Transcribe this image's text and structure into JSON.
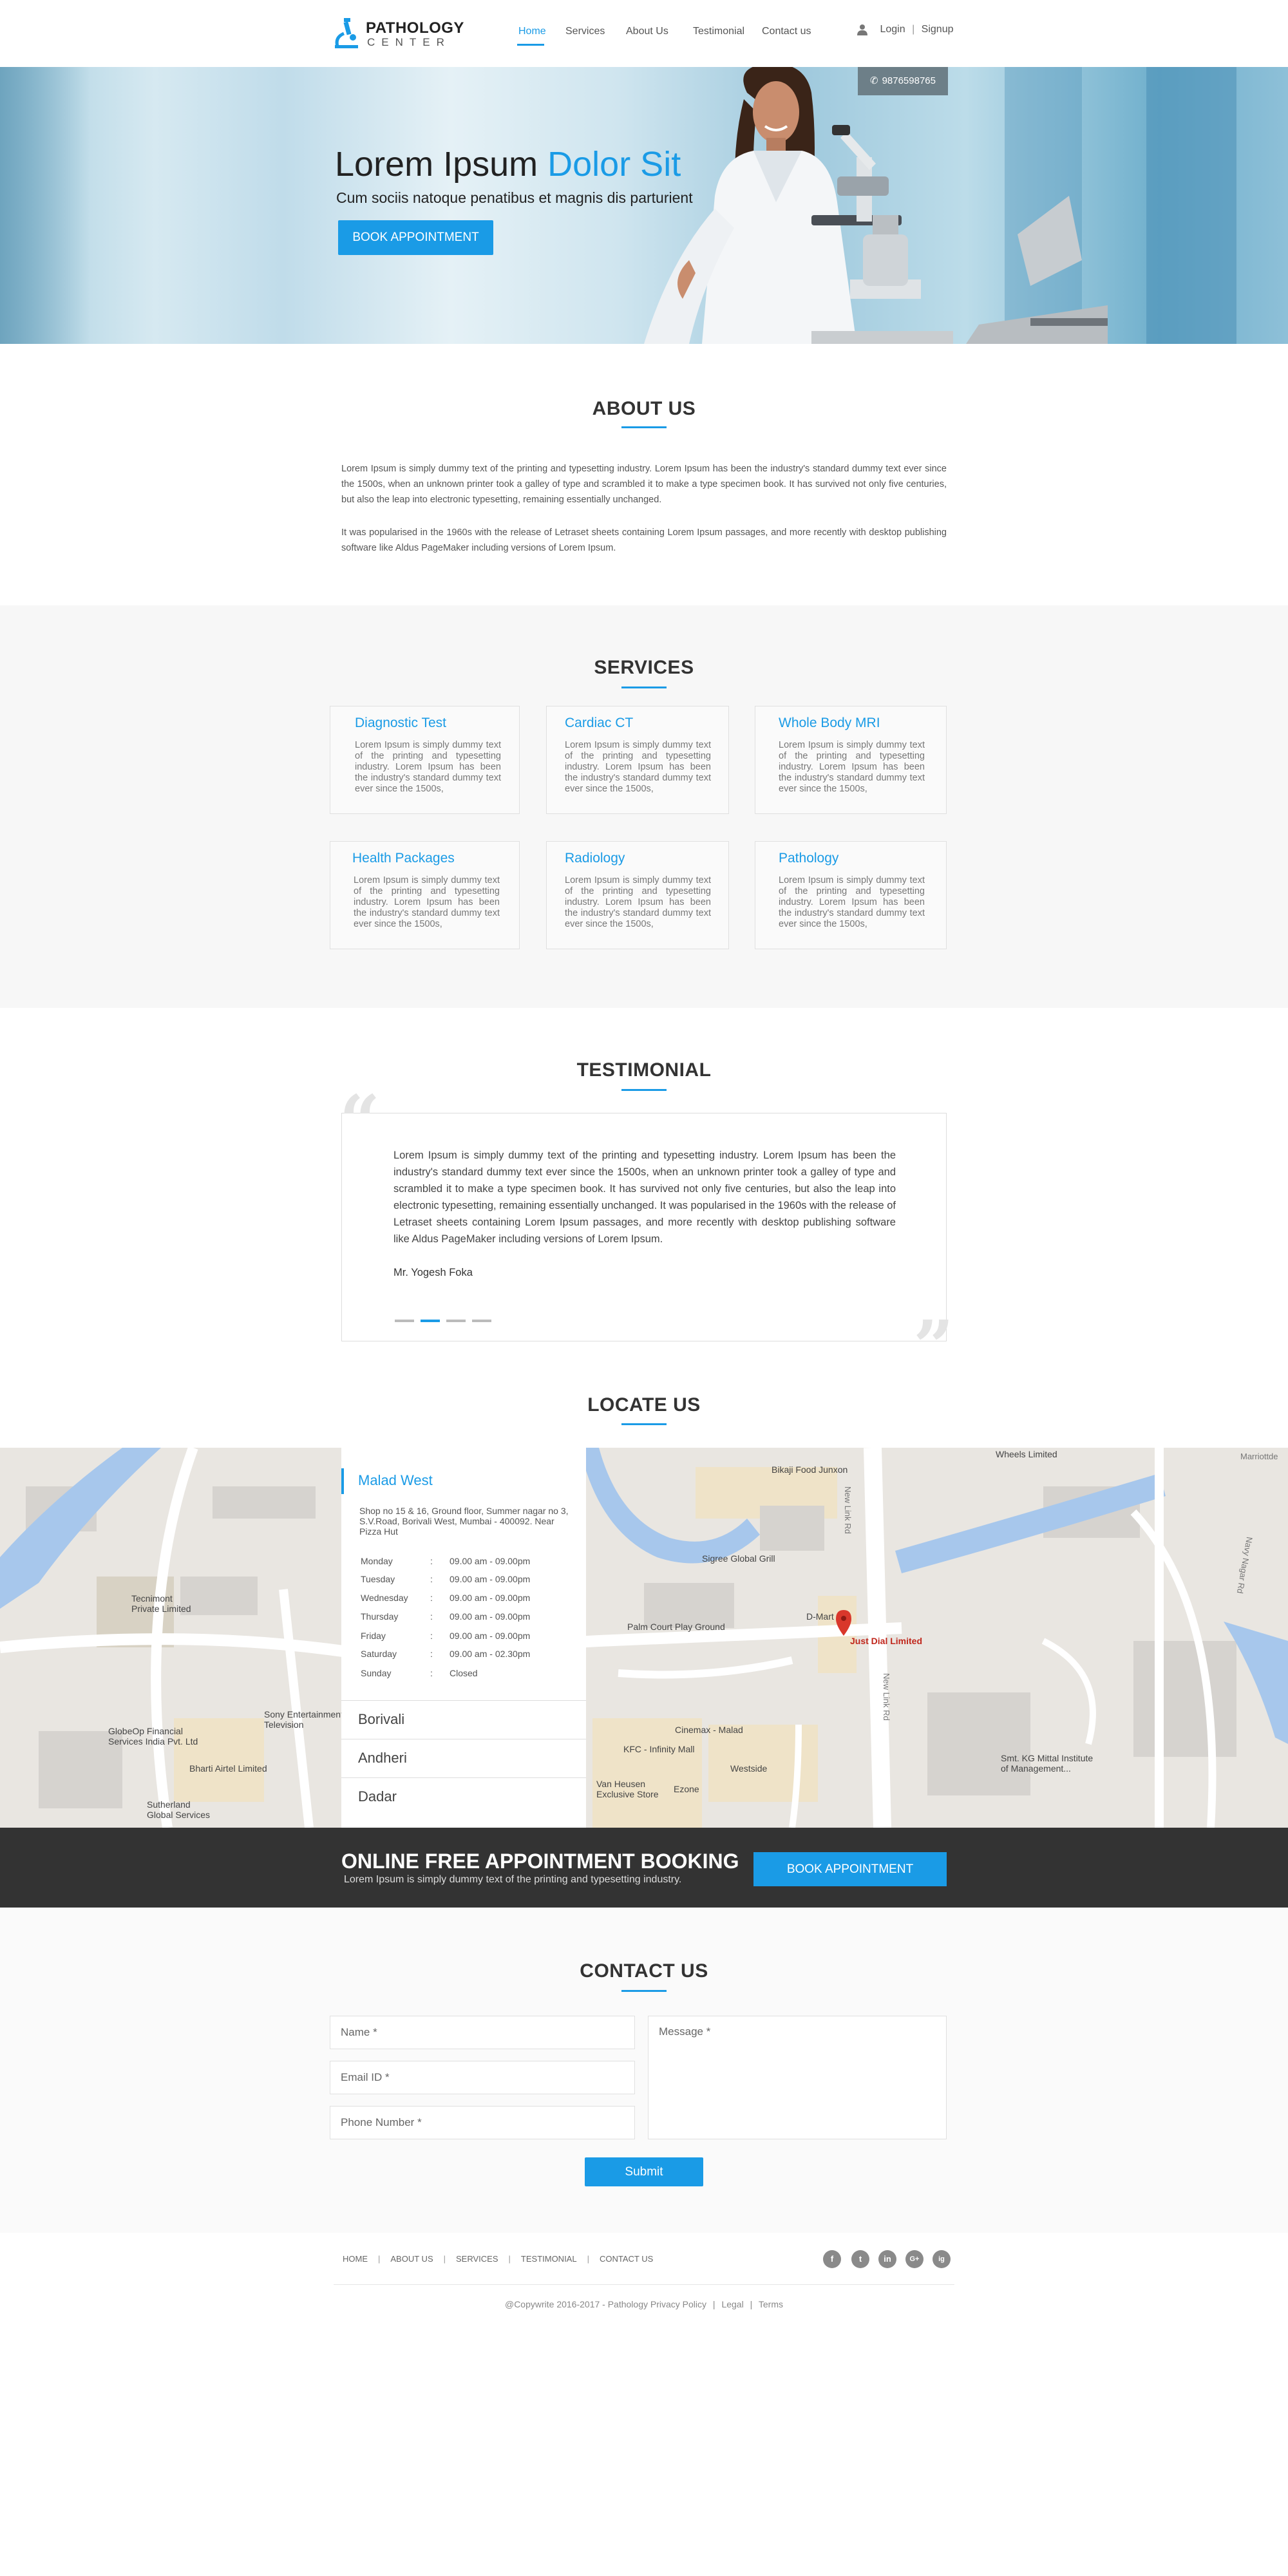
{
  "nav": {
    "logo_title": "PATHOLOGY",
    "logo_sub": "CENTER",
    "items": [
      "Home",
      "Services",
      "About Us",
      "Testimonial",
      "Contact us"
    ],
    "login": "Login",
    "divider": "|",
    "signup": "Signup"
  },
  "hero": {
    "title_plain": "Lorem Ipsum",
    "title_accent": "Dolor Sit",
    "subtitle": "Cum sociis natoque penatibus et magnis dis parturient",
    "button": "BOOK APPOINTMENT",
    "phone": "9876598765"
  },
  "about": {
    "title": "ABOUT US",
    "p1": "Lorem Ipsum is simply dummy text of the printing and typesetting industry. Lorem Ipsum has been the industry's standard dummy text ever since the 1500s, when an unknown printer took a galley of type and scrambled it to make a type specimen book. It has survived not only five centuries, but also the leap into electronic typesetting, remaining essentially unchanged.",
    "p2": "It was popularised in the 1960s with the release of Letraset sheets containing Lorem Ipsum passages, and more recently with desktop publishing software like Aldus PageMaker including versions of Lorem Ipsum."
  },
  "services": {
    "title": "SERVICES",
    "items": [
      {
        "title": "Diagnostic Test",
        "desc": "Lorem Ipsum is simply dummy text of the printing and typesetting industry. Lorem Ipsum has been the industry's standard dummy text ever since the 1500s,"
      },
      {
        "title": "Cardiac CT",
        "desc": "Lorem Ipsum is simply dummy text of the printing and typesetting industry. Lorem Ipsum has been the industry's standard dummy text ever since the 1500s,"
      },
      {
        "title": "Whole Body MRI",
        "desc": "Lorem Ipsum is simply dummy text of the printing and typesetting industry. Lorem Ipsum has been the industry's standard dummy text ever since the 1500s,"
      },
      {
        "title": "Health Packages",
        "desc": "Lorem Ipsum is simply dummy text of the printing and typesetting industry. Lorem Ipsum has been the industry's standard dummy text ever since the 1500s,"
      },
      {
        "title": "Radiology",
        "desc": "Lorem Ipsum is simply dummy text of the printing and typesetting industry. Lorem Ipsum has been the industry's standard dummy text ever since the 1500s,"
      },
      {
        "title": "Pathology",
        "desc": "Lorem Ipsum is simply dummy text of the printing and typesetting industry. Lorem Ipsum has been the industry's standard dummy text ever since the 1500s,"
      }
    ]
  },
  "testimonial": {
    "title": "TESTIMONIAL",
    "text": "Lorem Ipsum is simply dummy text of the printing and typesetting industry. Lorem Ipsum has been the industry's standard dummy text ever since the 1500s, when an unknown printer took a galley of type and scrambled it to make a type specimen book. It has survived not only five centuries, but also the leap into electronic typesetting, remaining essentially unchanged. It was popularised in the 1960s with the release of Letraset sheets containing Lorem Ipsum passages, and more recently with desktop publishing software like Aldus PageMaker including versions of Lorem Ipsum.",
    "author": "Mr. Yogesh Foka",
    "open_quote": "“",
    "close_quote": "”",
    "slide_count": 4,
    "active_slide": 2
  },
  "locate": {
    "title": "LOCATE US",
    "active_location": "Malad West",
    "address": "Shop no 15 & 16, Ground floor, Summer nagar no 3, S.V.Road, Borivali West, Mumbai - 400092. Near Pizza Hut",
    "hours": [
      {
        "day": "Monday",
        "sep": ":",
        "time": "09.00 am - 09.00pm"
      },
      {
        "day": "Tuesday",
        "sep": ":",
        "time": "09.00 am - 09.00pm"
      },
      {
        "day": "Wednesday",
        "sep": ":",
        "time": "09.00 am - 09.00pm"
      },
      {
        "day": "Thursday",
        "sep": ":",
        "time": "09.00 am - 09.00pm"
      },
      {
        "day": "Friday",
        "sep": ":",
        "time": "09.00 am - 09.00pm"
      },
      {
        "day": "Saturday",
        "sep": ":",
        "time": "09.00 am - 02.30pm"
      },
      {
        "day": "Sunday",
        "sep": ":",
        "time": "Closed"
      }
    ],
    "other_locations": [
      "Borivali",
      "Andheri",
      "Dadar"
    ],
    "map_labels": {
      "tecnimont": "Tecnimont\nPrivate Limited",
      "globeop": "GlobeOp Financial\nServices India Pvt. Ltd",
      "sony": "Sony Entertainment\nTelevision",
      "bharti": "Bharti Airtel Limited",
      "sutherland": "Sutherland\nGlobal Services",
      "bikaji": "Bikaji Food Junxon",
      "sigree": "Sigree Global Grill",
      "palm": "Palm Court Play Ground",
      "dmart": "D-Mart",
      "justdial": "Just Dial Limited",
      "cinemax": "Cinemax - Malad",
      "kfc": "KFC - Infinity Mall",
      "westside": "Westside",
      "vanheusen": "Van Heusen\nExclusive Store",
      "ezone": "Ezone",
      "wheels": "Wheels Limited",
      "marriott": "Marriottde",
      "newlink1": "New Link Rd",
      "newlink2": "New Link Rd",
      "navynagar": "Navy Nagar Rd",
      "kgmittal": "Smt. KG Mittal Institute\nof Management..."
    }
  },
  "booking": {
    "title": "ONLINE FREE APPOINTMENT BOOKING",
    "subtitle": "Lorem Ipsum is simply dummy text of the printing and typesetting industry.",
    "button": "BOOK APPOINTMENT"
  },
  "contact": {
    "title": "CONTACT US",
    "name_placeholder": "Name *",
    "email_placeholder": "Email ID *",
    "phone_placeholder": "Phone Number *",
    "message_placeholder": "Message *",
    "submit": "Submit"
  },
  "footer": {
    "links": [
      "HOME",
      "ABOUT US",
      "SERVICES",
      "TESTIMONIAL",
      "CONTACT US"
    ],
    "link_sep": "|",
    "social": [
      "facebook-icon",
      "twitter-icon",
      "linkedin-icon",
      "google-plus-icon",
      "instagram-icon"
    ],
    "social_glyphs": [
      "f",
      "t",
      "in",
      "G+",
      "ig"
    ],
    "copyright": "@Copywrite 2016-2017 - Pathology",
    "privacy": "Privacy Policy",
    "legal": "Legal",
    "terms": "Terms",
    "sep": "|"
  },
  "colors": {
    "accent": "#1a9be6",
    "dark_bar": "#333333",
    "section_bg": "#f7f7f7"
  }
}
